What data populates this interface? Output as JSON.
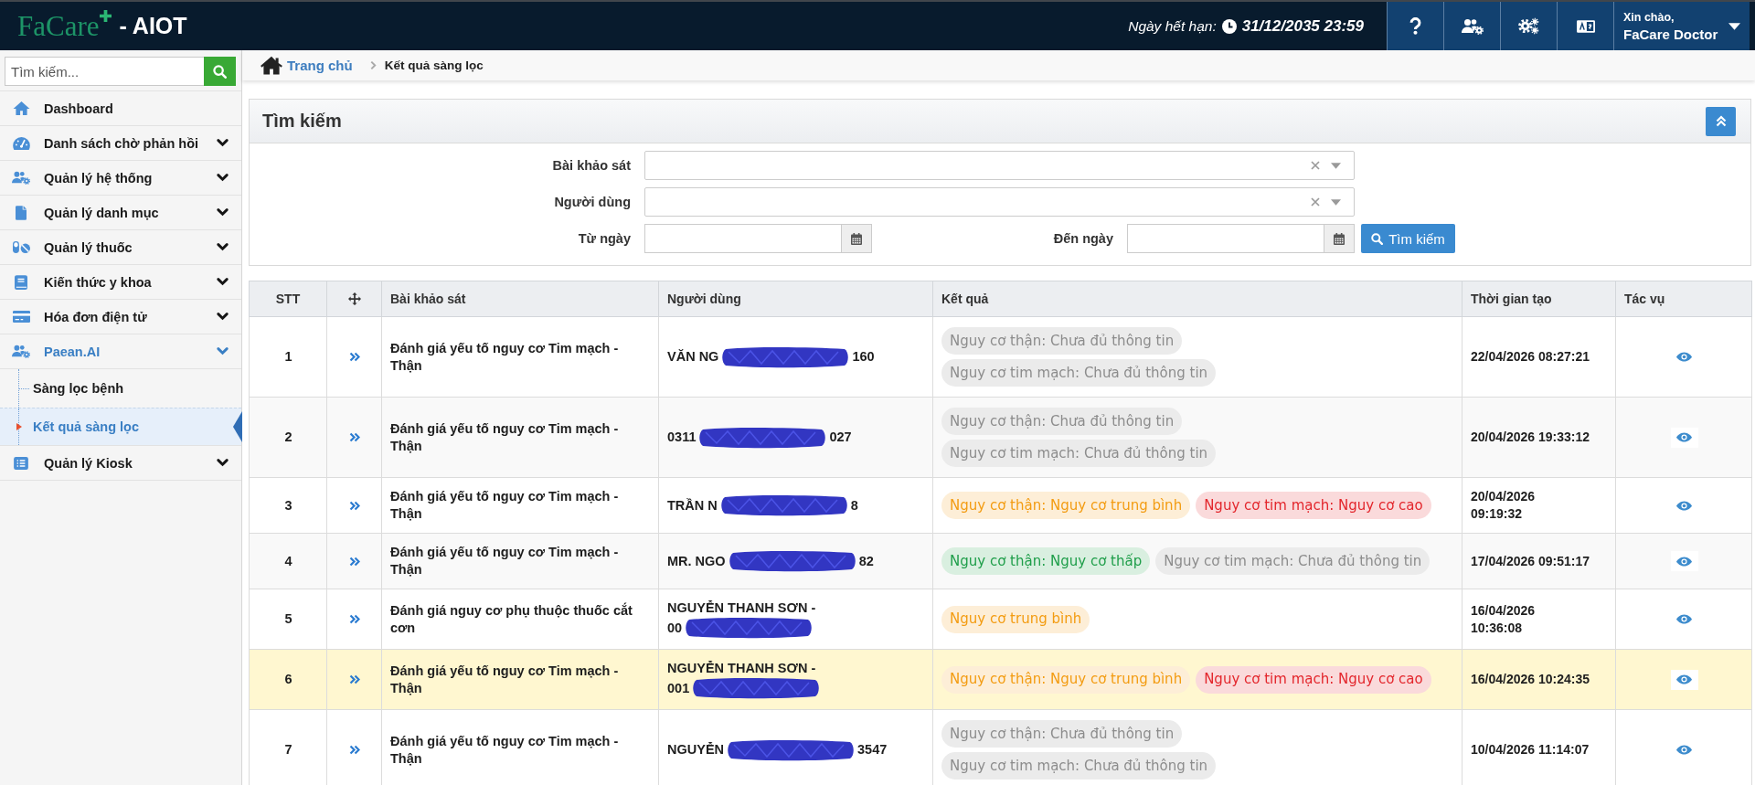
{
  "header": {
    "logo": {
      "brand": "FaCare",
      "suffix": "- AIOT"
    },
    "expiry": {
      "label": "Ngày hết hạn:",
      "value": "31/12/2035 23:59"
    },
    "user": {
      "greeting": "Xin chào,",
      "name": "FaCare Doctor"
    }
  },
  "sidebar": {
    "search": {
      "placeholder": "Tìm kiếm..."
    },
    "items": [
      {
        "label": "Dashboard",
        "kind": "link",
        "selected": false
      },
      {
        "label": "Danh sách chờ phản hồi",
        "kind": "group",
        "expanded": false,
        "selected": false
      },
      {
        "label": "Quản lý hệ thống",
        "kind": "group",
        "expanded": false,
        "selected": false
      },
      {
        "label": "Quản lý danh mục",
        "kind": "group",
        "expanded": false,
        "selected": false
      },
      {
        "label": "Quản lý thuốc",
        "kind": "group",
        "expanded": false,
        "selected": false
      },
      {
        "label": "Kiến thức y khoa",
        "kind": "group",
        "expanded": false,
        "selected": false
      },
      {
        "label": "Hóa đơn điện tử",
        "kind": "group",
        "expanded": false,
        "selected": false
      },
      {
        "label": "Paean.AI",
        "kind": "group",
        "expanded": true,
        "selected": false,
        "children": [
          {
            "label": "Sàng lọc bệnh",
            "selected": false
          },
          {
            "label": "Kết quả sàng lọc",
            "selected": true
          }
        ]
      },
      {
        "label": "Quản lý Kiosk",
        "kind": "group",
        "expanded": false,
        "selected": false
      }
    ]
  },
  "breadcrumb": [
    {
      "label": "Trang chủ",
      "kind": "link"
    },
    {
      "label": "Kết quả sàng lọc",
      "kind": "current"
    }
  ],
  "search_panel": {
    "title": "Tìm kiếm",
    "fields": [
      {
        "label": "Bài khảo sát",
        "kind": "select"
      },
      {
        "label": "Người dùng",
        "kind": "select"
      },
      {
        "label": "Từ ngày",
        "kind": "date"
      },
      {
        "label": "Đến ngày",
        "kind": "date"
      }
    ],
    "submit": "Tìm kiếm"
  },
  "table": {
    "columns": [
      {
        "kind": "text",
        "label": "STT"
      },
      {
        "kind": "icon"
      },
      {
        "kind": "text",
        "label": "Bài khảo sát"
      },
      {
        "kind": "text",
        "label": "Người dùng"
      },
      {
        "kind": "text",
        "label": "Kết quả"
      },
      {
        "kind": "text",
        "label": "Thời gian tạo"
      },
      {
        "kind": "text",
        "label": "Tác vụ"
      }
    ],
    "rows": [
      {
        "stt": "1",
        "survey": "Đánh giá yếu tố nguy cơ Tim mạch - Thận",
        "user": {
          "text": "VĂN NG",
          "redacted": true,
          "text_after": "160"
        },
        "results": [
          {
            "text": "Nguy cơ thận: Chưa đủ thông tin",
            "color": "#8c8c8c"
          },
          {
            "text": "Nguy cơ tim mạch: Chưa đủ thông tin",
            "color": "#8c8c8c"
          }
        ],
        "created": "22/04/2026 08:27:21",
        "highlighted": false
      },
      {
        "stt": "2",
        "survey": "Đánh giá yếu tố nguy cơ Tim mạch - Thận",
        "user": {
          "text": "0311",
          "redacted": true,
          "text_after": "027"
        },
        "results": [
          {
            "text": "Nguy cơ thận: Chưa đủ thông tin",
            "color": "#8c8c8c"
          },
          {
            "text": "Nguy cơ tim mạch: Chưa đủ thông tin",
            "color": "#8c8c8c"
          }
        ],
        "created": "20/04/2026 19:33:12",
        "highlighted": false
      },
      {
        "stt": "3",
        "survey": "Đánh giá yếu tố nguy cơ Tim mạch - Thận",
        "user": {
          "text": "TRẦN N",
          "redacted": true,
          "text_after": "8"
        },
        "results": [
          {
            "text": "Nguy cơ thận: Nguy cơ trung bình",
            "color": "#f39c12"
          },
          {
            "text": "Nguy cơ tim mạch: Nguy cơ cao",
            "color": "#e3262c"
          }
        ],
        "created": "20/04/2026\n09:19:32",
        "highlighted": false
      },
      {
        "stt": "4",
        "survey": "Đánh giá yếu tố nguy cơ Tim mạch - Thận",
        "user": {
          "text": "MR. NGO",
          "redacted": true,
          "text_after": "82"
        },
        "results": [
          {
            "text": "Nguy cơ thận: Nguy cơ thấp",
            "color": "#1f9e4a"
          },
          {
            "text": "Nguy cơ tim mạch: Chưa đủ thông tin",
            "color": "#8c8c8c"
          }
        ],
        "created": "17/04/2026 09:51:17",
        "highlighted": false
      },
      {
        "stt": "5",
        "survey": "Đánh giá nguy cơ phụ thuộc thuốc cắt cơn",
        "user": {
          "text": "NGUYỄN THANH SƠN -\n00",
          "redacted": true
        },
        "results": [
          {
            "text": "Nguy cơ trung bình",
            "color": "#f39c12"
          }
        ],
        "created": "16/04/2026\n10:36:08",
        "highlighted": false
      },
      {
        "stt": "6",
        "survey": "Đánh giá yếu tố nguy cơ Tim mạch - Thận",
        "user": {
          "text": "NGUYỄN THANH SƠN -\n001",
          "redacted": true
        },
        "results": [
          {
            "text": "Nguy cơ thận: Nguy cơ trung bình",
            "color": "#f39c12"
          },
          {
            "text": "Nguy cơ tim mạch: Nguy cơ cao",
            "color": "#e3262c"
          }
        ],
        "created": "16/04/2026 10:24:35",
        "highlighted": true
      },
      {
        "stt": "7",
        "survey": "Đánh giá yếu tố nguy cơ Tim mạch - Thận",
        "user": {
          "text": "NGUYỄN",
          "redacted": true,
          "text_after": "3547"
        },
        "results": [
          {
            "text": "Nguy cơ thận: Chưa đủ thông tin",
            "color": "#8c8c8c"
          },
          {
            "text": "Nguy cơ tim mạch: Chưa đủ thông tin",
            "color": "#8c8c8c"
          }
        ],
        "created": "10/04/2026 11:14:07",
        "highlighted": false
      }
    ]
  }
}
